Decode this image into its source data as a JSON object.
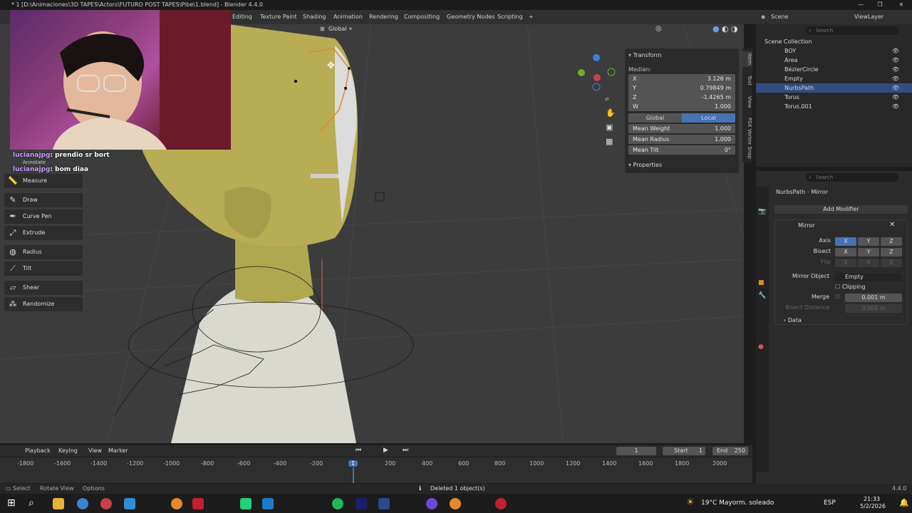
{
  "window": {
    "title": "* 1 [D:\\Animaciones\\3D TAPES\\Actors\\FUTURO POST TAPES\\Pibe\\1.blend] - Blender 4.4.0",
    "controls": [
      "—",
      "❐",
      "✕"
    ]
  },
  "workspaces": [
    "Editing",
    "Texture Paint",
    "Shading",
    "Animation",
    "Rendering",
    "Compositing",
    "Geometry Nodes",
    "Scripting",
    "+"
  ],
  "header_right": {
    "scene": "Scene",
    "view_layer": "ViewLayer"
  },
  "viewport": {
    "orientation": "Global",
    "colors": {
      "bg": "#3c3c3c",
      "skin": "#b8ad55",
      "shirt": "#d9d9d0",
      "grid": "#464646"
    }
  },
  "chat": [
    {
      "user": "lucianajpg",
      "text": ": prendio sr bort"
    },
    {
      "user": "lucianajpg",
      "text": ": bom diaa"
    }
  ],
  "tools": [
    {
      "label": "Annotate",
      "icon": "annotate-icon"
    },
    {
      "label": "Measure",
      "icon": "ruler-icon"
    },
    {
      "label": "Draw",
      "icon": "draw-icon"
    },
    {
      "label": "Curve Pen",
      "icon": "curve-pen-icon"
    },
    {
      "label": "Extrude",
      "icon": "extrude-icon"
    },
    {
      "label": "Radius",
      "icon": "radius-icon"
    },
    {
      "label": "Tilt",
      "icon": "tilt-icon"
    },
    {
      "label": "Shear",
      "icon": "shear-icon"
    },
    {
      "label": "Randomize",
      "icon": "randomize-icon"
    }
  ],
  "transform": {
    "title": "Transform",
    "median_label": "Median:",
    "fields": [
      {
        "axis": "X",
        "value": "3.126 m"
      },
      {
        "axis": "Y",
        "value": "0.79849 m"
      },
      {
        "axis": "Z",
        "value": "-1.4265 m"
      },
      {
        "axis": "W",
        "value": "1.000"
      }
    ],
    "space": {
      "global": "Global",
      "local": "Local"
    },
    "extra": [
      {
        "label": "Mean Weight",
        "value": "1.000"
      },
      {
        "label": "Mean Radius",
        "value": "1.000"
      },
      {
        "label": "Mean Tilt",
        "value": "0°"
      }
    ],
    "properties_label": "Properties"
  },
  "sidebar_tabs": [
    "Item",
    "Tool",
    "View",
    "PSX Vertex Snap"
  ],
  "outliner": {
    "search_placeholder": "Search",
    "root": "Scene Collection",
    "items": [
      {
        "name": "BOY"
      },
      {
        "name": "Area"
      },
      {
        "name": "BézierCircle"
      },
      {
        "name": "Empty"
      },
      {
        "name": "NurbsPath",
        "selected": true
      },
      {
        "name": "Torus"
      },
      {
        "name": "Torus.001"
      }
    ]
  },
  "properties": {
    "search_placeholder": "Search",
    "breadcrumb": {
      "object": "NurbsPath",
      "modifier": "Mirror"
    },
    "add_modifier": "Add Modifier",
    "modifier_name": "Mirror",
    "axis_label": "Axis",
    "bisect_label": "Bisect",
    "flip_label": "Flip",
    "axes": [
      "X",
      "Y",
      "Z"
    ],
    "mirror_object_label": "Mirror Object",
    "mirror_object_value": "Empty",
    "clipping_label": "Clipping",
    "merge_label": "Merge",
    "merge_value": "0.001 m",
    "bisect_distance_label": "Bisect Distance",
    "bisect_distance_value": "0.001 m",
    "data_label": "Data"
  },
  "timeline": {
    "menus": [
      "Playback",
      "Keying",
      "View",
      "Marker"
    ],
    "current_frame": "1",
    "start_label": "Start",
    "start_value": "1",
    "end_label": "End",
    "end_value": "250",
    "ticks": [
      "-1800",
      "-1600",
      "-1400",
      "-1200",
      "-1000",
      "-800",
      "-600",
      "-400",
      "-200",
      "1",
      "200",
      "400",
      "600",
      "800",
      "1000",
      "1200",
      "1400",
      "1600",
      "1800",
      "2000"
    ]
  },
  "status": {
    "select": "Select",
    "rotate": "Rotate View",
    "options": "Options",
    "message": "Deleted 1 object(s)",
    "version": "4.4.0"
  },
  "taskbar": {
    "weather": "19°C  Mayorm. soleado",
    "lang": "ESP",
    "time": "21:33",
    "date": "5/2/2026"
  }
}
